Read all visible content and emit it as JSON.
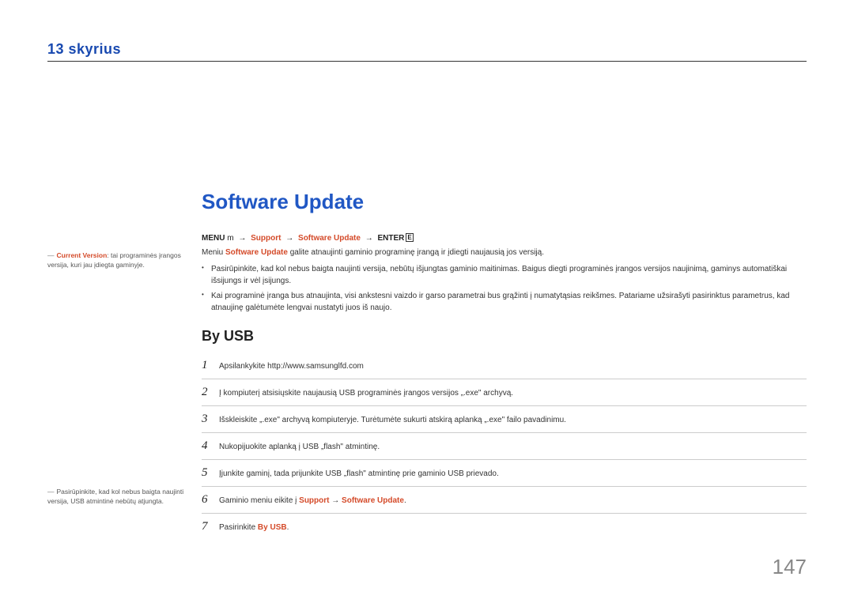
{
  "header": {
    "chapter_brand": "13 skyrius"
  },
  "sidenote1": {
    "dash": "―",
    "label": "Current Version",
    "text": ": tai programinės įrangos versija, kuri jau įdiegta gaminyje."
  },
  "sidenote2": {
    "dash": "―",
    "text": "Pasirūpinkite, kad kol nebus baigta naujinti versija, USB atmintinė nebūtų atjungta."
  },
  "title": "Software Update",
  "menu_path": {
    "menu": "MENU",
    "m": "m",
    "arrow": "→",
    "p1": "Support",
    "p2": "Software Update",
    "enter": "ENTER",
    "e": "E"
  },
  "desc_prefix": "Meniu ",
  "desc_bold": "Software Update",
  "desc_suffix": " galite atnaujinti gaminio programinę įrangą ir įdiegti naujausią jos versiją.",
  "bullets": [
    "Pasirūpinkite, kad kol nebus baigta naujinti versija, nebūtų išjungtas gaminio maitinimas. Baigus diegti programinės įrangos versijos naujinimą, gaminys automatiškai išsijungs ir vėl įsijungs.",
    "Kai programinė įranga bus atnaujinta, visi ankstesni vaizdo ir garso parametrai bus grąžinti į numatytąsias reikšmes. Patariame užsirašyti pasirinktus parametrus, kad atnaujinę galėtumėte lengvai nustatyti juos iš naujo."
  ],
  "subtitle": "By USB",
  "steps": [
    {
      "n": "1",
      "text": "Apsilankykite http://www.samsunglfd.com"
    },
    {
      "n": "2",
      "text": "Į kompiuterį atsisiųskite naujausią USB programinės įrangos versijos „.exe\" archyvą."
    },
    {
      "n": "3",
      "text": "Išskleiskite „.exe\" archyvą kompiuteryje. Turėtumėte sukurti atskirą aplanką „.exe\" failo pavadinimu."
    },
    {
      "n": "4",
      "text": "Nukopijuokite aplanką į USB „flash\" atmintinę."
    },
    {
      "n": "5",
      "text": "Įjunkite gaminį, tada prijunkite USB „flash\" atmintinę prie gaminio USB prievado."
    }
  ],
  "step6": {
    "n": "6",
    "prefix": "Gaminio meniu eikite į ",
    "bold1": "Support",
    "arrow": " → ",
    "bold2": "Software Update",
    "suffix": "."
  },
  "step7": {
    "n": "7",
    "prefix": "Pasirinkite ",
    "bold": "By USB",
    "suffix": "."
  },
  "page_number": "147"
}
